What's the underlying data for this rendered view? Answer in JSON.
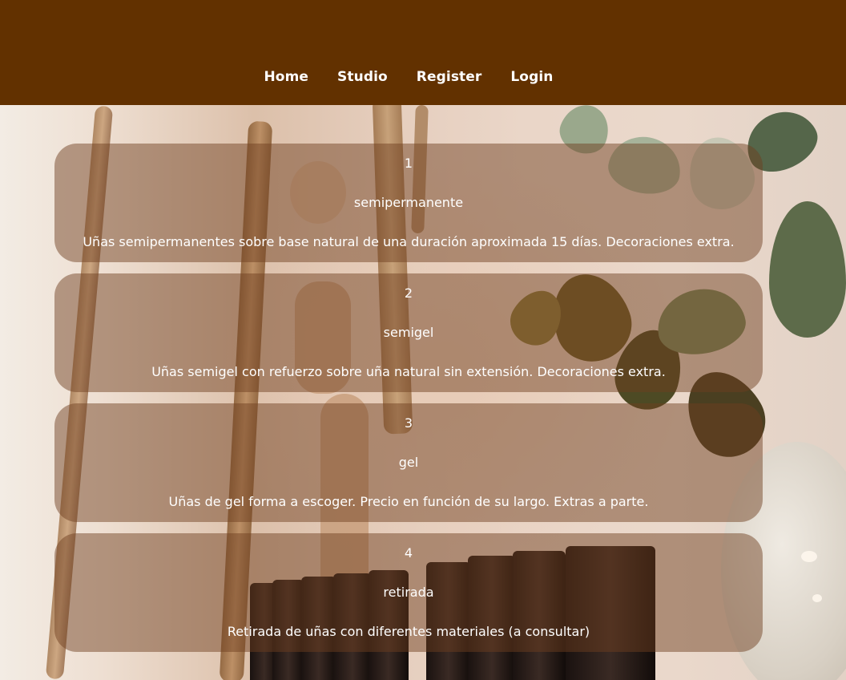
{
  "nav": {
    "items": [
      {
        "label": "Home"
      },
      {
        "label": "Studio"
      },
      {
        "label": "Register"
      },
      {
        "label": "Login"
      }
    ]
  },
  "services": [
    {
      "number": "1",
      "name": "semipermanente",
      "description": "Uñas semipermanentes sobre base natural de una duración aproximada 15 días. Decoraciones extra."
    },
    {
      "number": "2",
      "name": "semigel",
      "description": "Uñas semigel con refuerzo sobre uña natural sin extensión. Decoraciones extra."
    },
    {
      "number": "3",
      "name": "gel",
      "description": "Uñas de gel forma a escoger. Precio en función de su largo. Extras a parte."
    },
    {
      "number": "4",
      "name": "retirada",
      "description": "Retirada de uñas con diferentes materiales (a consultar)"
    }
  ],
  "colors": {
    "header_bg": "#623100",
    "card_bg": "rgba(110, 62, 32, 0.48)",
    "text": "#ffffff"
  }
}
